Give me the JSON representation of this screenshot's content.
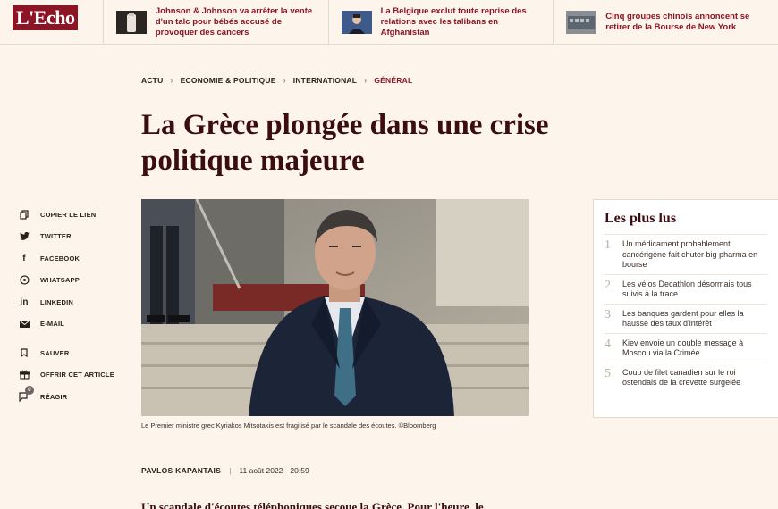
{
  "header": {
    "logo": "L'Echo",
    "news": [
      {
        "thumb": "johnson-talc-thumbnail",
        "text": "Johnson & Johnson va arrêter la vente d'un talc pour bébés accusé de provoquer des cancers"
      },
      {
        "thumb": "belgium-minister-thumbnail",
        "text": "La Belgique exclut toute reprise des relations avec les talibans en Afghanistan"
      },
      {
        "thumb": "chinese-companies-thumbnail",
        "text": "Cinq groupes chinois annoncent se retirer de la Bourse de New York"
      }
    ]
  },
  "breadcrumb": {
    "items": [
      "ACTU",
      "ECONOMIE & POLITIQUE",
      "INTERNATIONAL"
    ],
    "current": "GÉNÉRAL"
  },
  "article": {
    "title": "La Grèce plongée dans une crise politique majeure",
    "caption": "Le Premier ministre grec Kyriakos Mitsotakis est fragilisé par le scandale des écoutes. ©Bloomberg",
    "author": "PAVLOS KAPANTAIS",
    "date": "11 août 2022",
    "time": "20:59",
    "lead": "Un scandale d'écoutes téléphoniques secoue la Grèce. Pour l'heure, le"
  },
  "share": {
    "copy": "COPIER LE LIEN",
    "twitter": "TWITTER",
    "facebook": "FACEBOOK",
    "whatsapp": "WHATSAPP",
    "linkedin": "LINKEDIN",
    "email": "E-MAIL",
    "save": "SAUVER",
    "gift": "OFFRIR CET ARTICLE",
    "react": "RÉAGIR",
    "react_count": "0"
  },
  "most_read": {
    "title": "Les plus lus",
    "items": [
      {
        "num": "1",
        "text": "Un médicament probablement cancérigène fait chuter big pharma en bourse"
      },
      {
        "num": "2",
        "text": "Les vélos Decathlon désormais tous suivis à la trace"
      },
      {
        "num": "3",
        "text": "Les banques gardent pour elles la hausse des taux d'intérêt"
      },
      {
        "num": "4",
        "text": "Kiev envoie un double message à Moscou via la Crimée"
      },
      {
        "num": "5",
        "text": "Coup de filet canadien sur le roi ostendais de la crevette surgelée"
      }
    ]
  },
  "colors": {
    "brand": "#8c1525",
    "title": "#3a0d10",
    "background": "#fdf5ec"
  }
}
